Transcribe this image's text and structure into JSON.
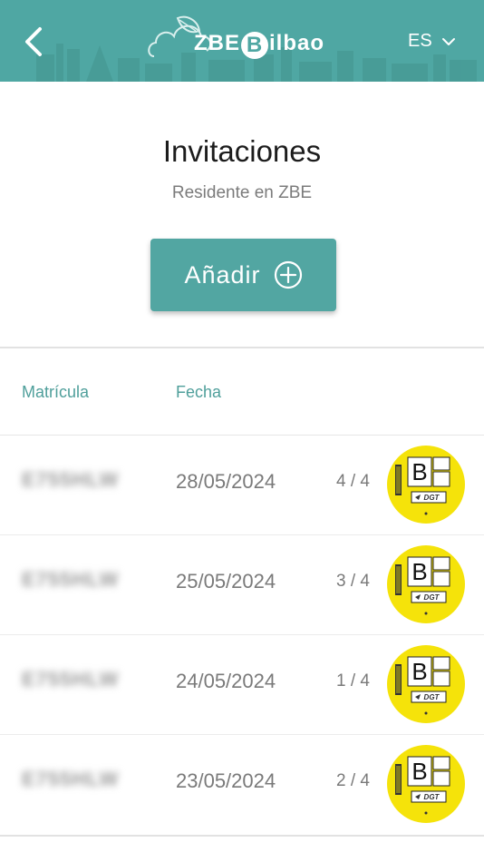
{
  "header": {
    "logo_prefix": "ZBE",
    "logo_letter": "B",
    "logo_suffix": "ilbao",
    "language": "ES"
  },
  "page": {
    "title": "Invitaciones",
    "subtitle": "Residente en ZBE",
    "add_label": "Añadir"
  },
  "table": {
    "columns": [
      "Matrícula",
      "Fecha"
    ],
    "rows": [
      {
        "plate": "E755HLW",
        "date": "28/05/2024",
        "count": "4 / 4"
      },
      {
        "plate": "E755HLW",
        "date": "25/05/2024",
        "count": "3 / 4"
      },
      {
        "plate": "E755HLW",
        "date": "24/05/2024",
        "count": "1 / 4"
      },
      {
        "plate": "E755HLW",
        "date": "23/05/2024",
        "count": "2 / 4"
      }
    ]
  },
  "badge": {
    "letter": "B",
    "issuer": "DGT",
    "color": "#f5e30a"
  },
  "colors": {
    "brand": "#4fa7a3",
    "button": "#52a6a2",
    "column_header": "#4f9f9b"
  },
  "icons": {
    "back": "chevron-left-icon",
    "language_toggle": "chevron-down-icon",
    "add": "plus-circle-icon",
    "logo": "cloud-leaf-icon"
  }
}
